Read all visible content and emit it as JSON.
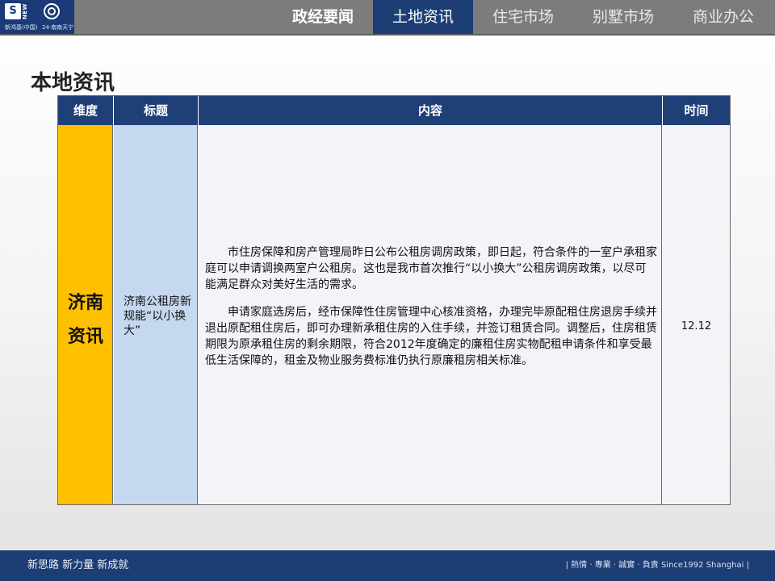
{
  "header": {
    "logo": {
      "name_text": "新鸿基(中国)",
      "mark_text": "NEW",
      "slogan_text": "24·南南天宁"
    },
    "tabs": [
      {
        "label": "政经要闻",
        "bold": true
      },
      {
        "label": "土地资讯",
        "active": true
      },
      {
        "label": "住宅市场"
      },
      {
        "label": "别墅市场"
      },
      {
        "label": "商业办公"
      }
    ]
  },
  "page": {
    "title": "本地资讯"
  },
  "table": {
    "columns": [
      "维度",
      "标题",
      "内容",
      "时间"
    ],
    "row": {
      "dimension": "济南资讯",
      "title": "济南公租房新规能“以小换大”",
      "content": [
        "市住房保障和房产管理局昨日公布公租房调房政策，即日起，符合条件的一室户承租家庭可以申请调换两室户公租房。这也是我市首次推行“以小换大”公租房调房政策，以尽可能满足群众对美好生活的需求。",
        "申请家庭选房后，经市保障性住房管理中心核准资格，办理完毕原配租住房退房手续并退出原配租住房后，即可办理新承租住房的入住手续，并签订租赁合同。调整后，住房租赁期限为原承租住房的剩余期限，符合2012年度确定的廉租住房实物配租申请条件和享受最低生活保障的，租金及物业服务费标准仍执行原廉租房相关标准。"
      ],
      "time": "12.12"
    }
  },
  "footer": {
    "left": "新思路  新力量  新成就",
    "right": "| 熱情 · 專業 · 誠實 · 負責  Since1992 Shanghai |"
  },
  "colors": {
    "header_bar": "#7c7c7c",
    "active_tab": "#1d3d75",
    "table_header": "#1f3f77",
    "dimension_cell": "#ffc000",
    "title_cell": "#c6d8f0",
    "footer": "#1d3d75"
  }
}
